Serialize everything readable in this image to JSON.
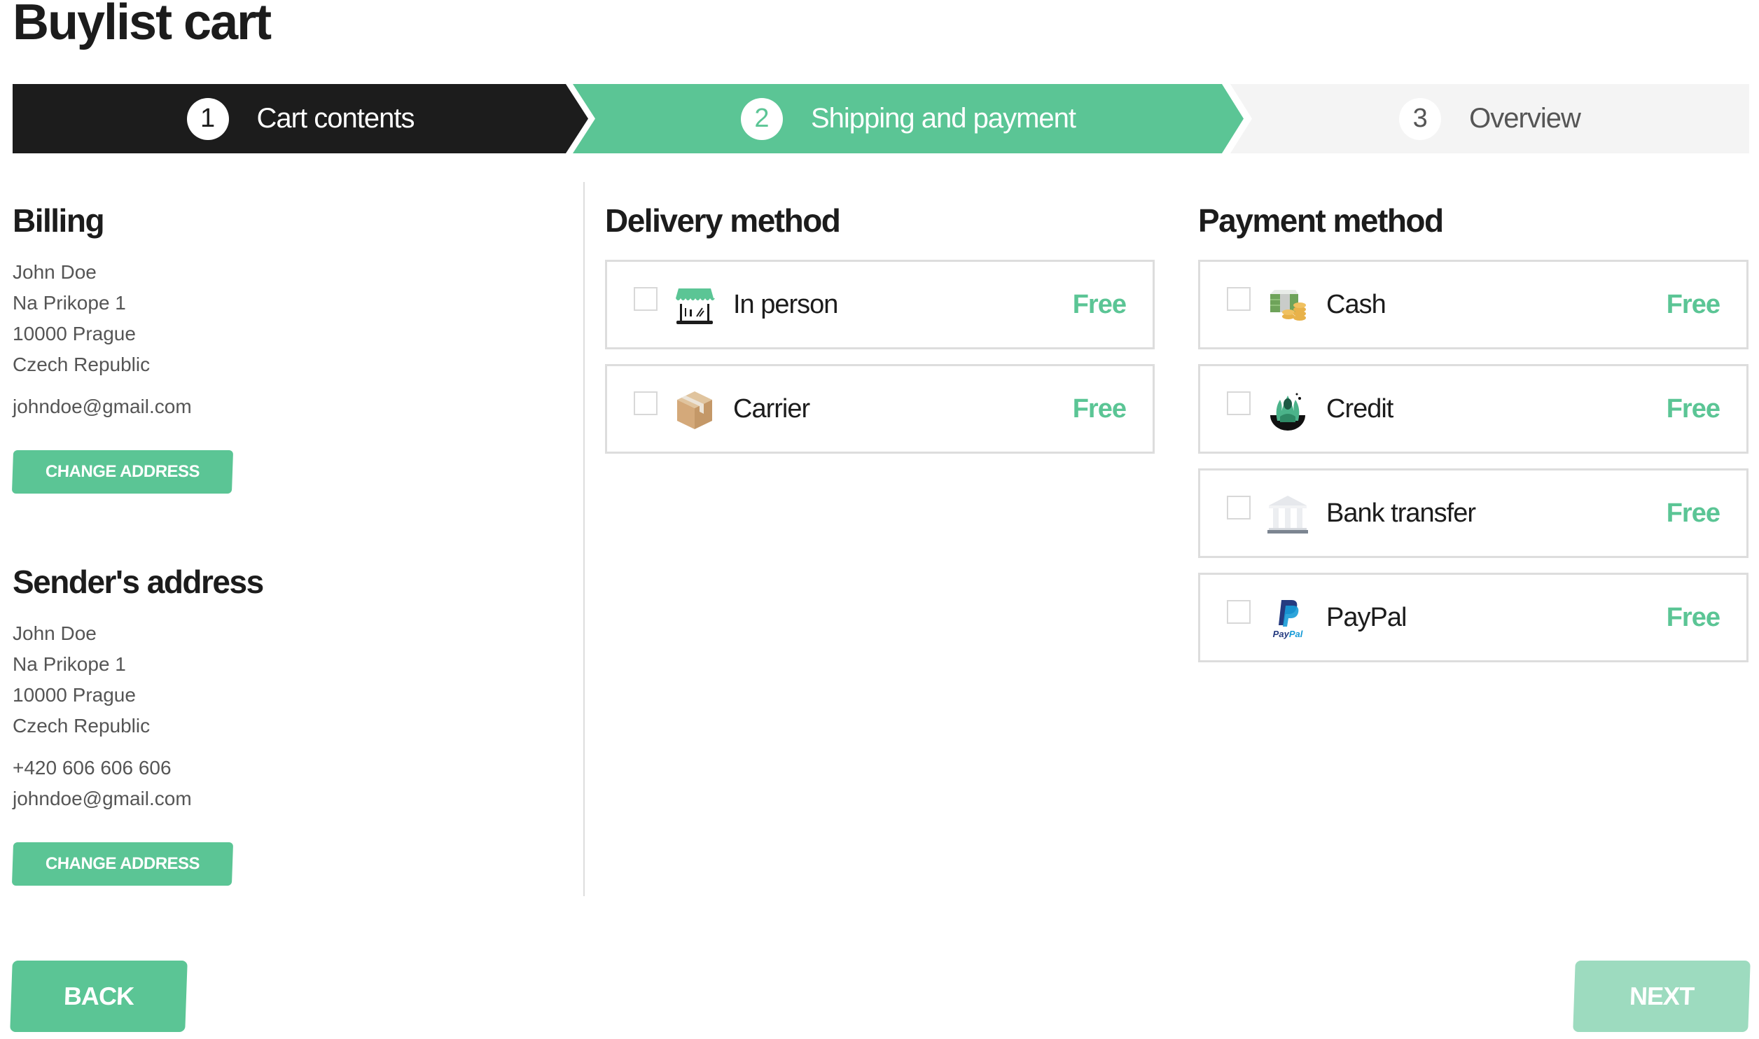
{
  "page": {
    "title": "Buylist cart"
  },
  "stepper": {
    "steps": [
      {
        "number": "1",
        "label": "Cart contents",
        "state": "completed"
      },
      {
        "number": "2",
        "label": "Shipping and payment",
        "state": "active"
      },
      {
        "number": "3",
        "label": "Overview",
        "state": "upcoming"
      }
    ]
  },
  "billing": {
    "heading": "Billing",
    "name": "John Doe",
    "street": "Na Prikope 1",
    "city": "10000 Prague",
    "country": "Czech Republic",
    "email": "johndoe@gmail.com",
    "button": "CHANGE ADDRESS"
  },
  "sender": {
    "heading": "Sender's address",
    "name": "John Doe",
    "street": "Na Prikope 1",
    "city": "10000 Prague",
    "country": "Czech Republic",
    "phone": "+420 606 606 606",
    "email": "johndoe@gmail.com",
    "button": "CHANGE ADDRESS"
  },
  "delivery": {
    "heading": "Delivery method",
    "options": [
      {
        "name": "In person",
        "price": "Free",
        "icon": "store-icon",
        "checked": false
      },
      {
        "name": "Carrier",
        "price": "Free",
        "icon": "package-icon",
        "checked": false
      }
    ]
  },
  "payment": {
    "heading": "Payment method",
    "options": [
      {
        "name": "Cash",
        "price": "Free",
        "icon": "cash-icon",
        "checked": false
      },
      {
        "name": "Credit",
        "price": "Free",
        "icon": "credit-icon",
        "checked": false
      },
      {
        "name": "Bank transfer",
        "price": "Free",
        "icon": "bank-icon",
        "checked": false
      },
      {
        "name": "PayPal",
        "price": "Free",
        "icon": "paypal-icon",
        "checked": false
      }
    ]
  },
  "nav": {
    "back": "BACK",
    "next": "NEXT"
  },
  "colors": {
    "accent": "#5bc595",
    "accent_disabled": "#9ddbbf",
    "dark": "#1c1c1c",
    "step_inactive": "#f4f4f4"
  }
}
